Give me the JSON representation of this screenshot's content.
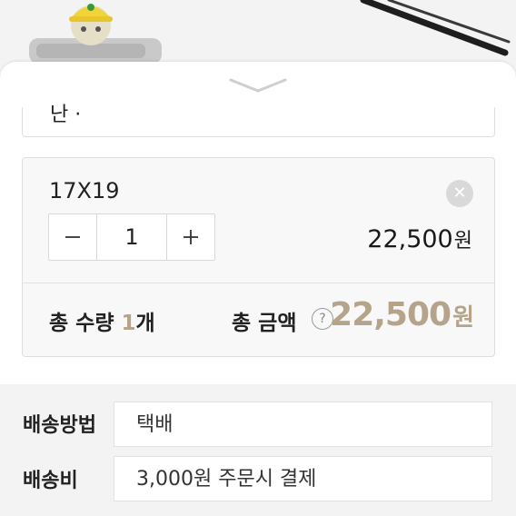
{
  "option": {
    "prev_partial": "난 ·",
    "name": "17X19",
    "remove_icon": "close-icon",
    "quantity": "1",
    "minus": "−",
    "plus": "+",
    "price": "22,500",
    "currency": "원"
  },
  "summary": {
    "qty_prefix": "총 수량 ",
    "qty_value": "1",
    "qty_suffix": "개",
    "amount_label": "총 금액",
    "help": "?",
    "total_price": "22,500",
    "currency": "원"
  },
  "shipping": {
    "method_label": "배송방법",
    "method_value": "택배",
    "fee_label": "배송비",
    "fee_value": "3,000원 주문시 결제"
  },
  "colors": {
    "accent": "#b5a48b",
    "sheet_bg": "#ffffff",
    "section_bg": "#f3f3f3",
    "border": "#dedede"
  }
}
